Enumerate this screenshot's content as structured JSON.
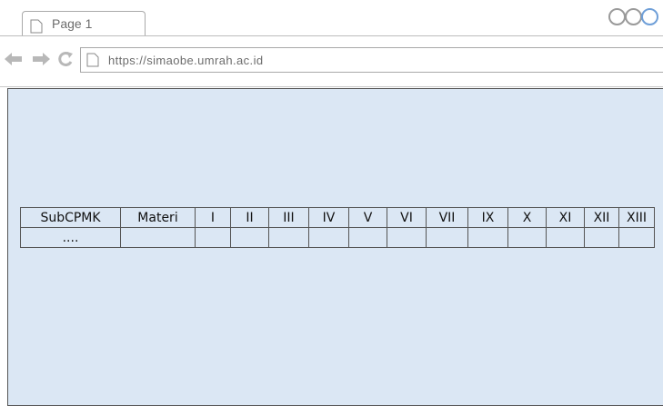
{
  "browser": {
    "tab_label": "Page 1",
    "url": "https://simaobe.umrah.ac.id",
    "nav_icons": [
      "back-arrow-icon",
      "forward-arrow-icon",
      "reload-icon"
    ]
  },
  "table": {
    "headers": [
      "SubCPMK",
      "Materi",
      "I",
      "II",
      "III",
      "IV",
      "V",
      "VI",
      "VII",
      "IX",
      "X",
      "XI",
      "XII",
      "XIII"
    ],
    "rows": [
      [
        "....",
        "",
        "",
        "",
        "",
        "",
        "",
        "",
        "",
        "",
        "",
        "",
        "",
        ""
      ]
    ]
  },
  "colors": {
    "viewport_bg": "#dbe7f4",
    "border": "#555555",
    "chrome_gray": "#b8b8b8"
  }
}
